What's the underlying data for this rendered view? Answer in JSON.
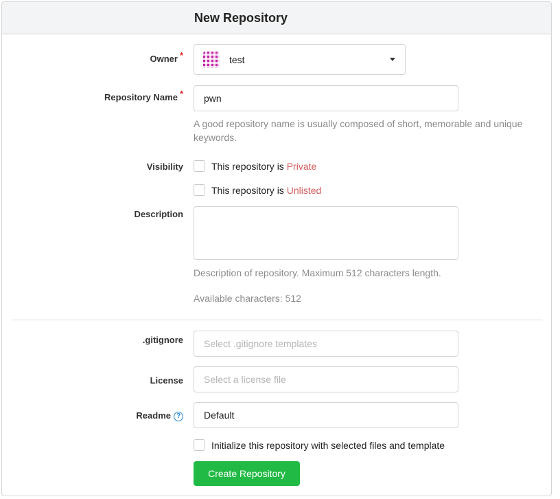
{
  "header": {
    "title": "New Repository"
  },
  "owner": {
    "label": "Owner",
    "required_mark": "*",
    "value": "test"
  },
  "repo_name": {
    "label": "Repository Name",
    "required_mark": "*",
    "value": "pwn",
    "help": "A good repository name is usually composed of short, memorable and unique keywords."
  },
  "visibility": {
    "label": "Visibility",
    "private_prefix": "This repository is ",
    "private_word": "Private",
    "unlisted_prefix": "This repository is ",
    "unlisted_word": "Unlisted"
  },
  "description": {
    "label": "Description",
    "help": "Description of repository. Maximum 512 characters length.",
    "available": "Available characters: 512"
  },
  "gitignore": {
    "label": ".gitignore",
    "placeholder": "Select .gitignore templates"
  },
  "license": {
    "label": "License",
    "placeholder": "Select a license file"
  },
  "readme": {
    "label": "Readme",
    "value": "Default",
    "help_glyph": "?"
  },
  "init": {
    "label": "Initialize this repository with selected files and template"
  },
  "submit": {
    "label": "Create Repository"
  },
  "colors": {
    "accent_green": "#21ba45",
    "required_red": "#db2828",
    "visibility_red": "#d25c5c",
    "help_blue": "#2185d0"
  }
}
